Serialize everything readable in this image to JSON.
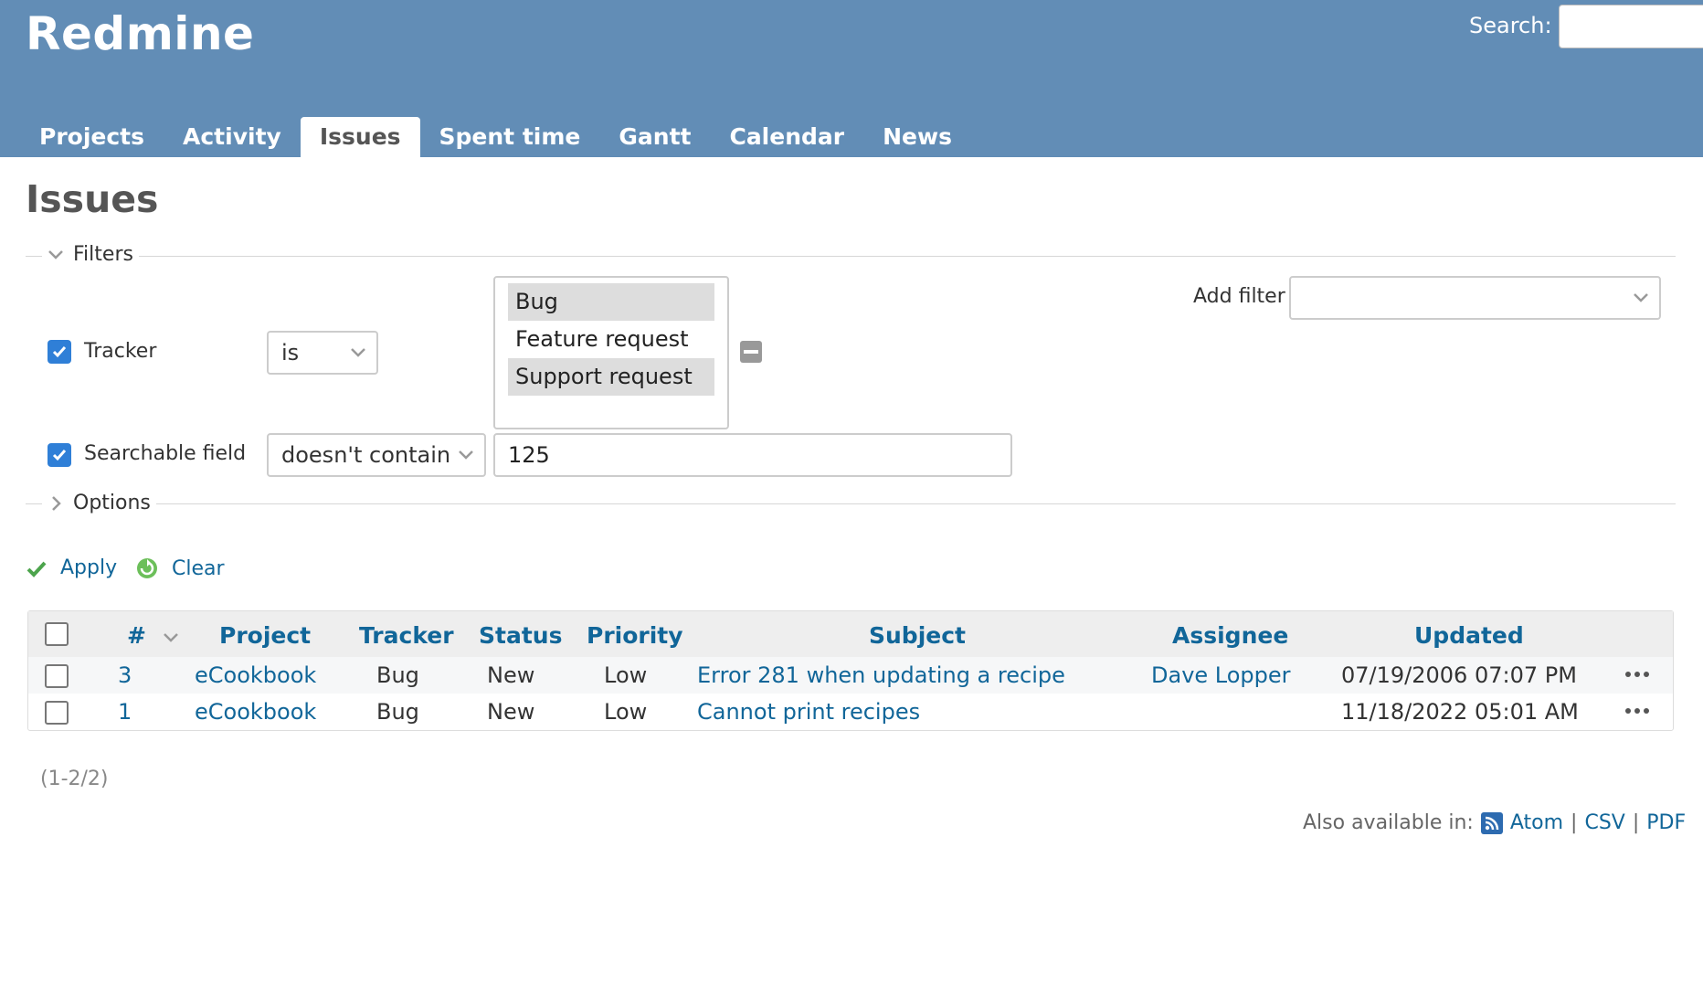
{
  "header": {
    "app_title": "Redmine",
    "search_label": "Search:",
    "search_value": "",
    "tabs": [
      {
        "label": "Projects"
      },
      {
        "label": "Activity"
      },
      {
        "label": "Issues",
        "selected": true
      },
      {
        "label": "Spent time"
      },
      {
        "label": "Gantt"
      },
      {
        "label": "Calendar"
      },
      {
        "label": "News"
      }
    ]
  },
  "main": {
    "title": "Issues",
    "filters": {
      "legend": "Filters",
      "tracker": {
        "checked": true,
        "label": "Tracker",
        "operator": "is",
        "options": [
          {
            "label": "Bug",
            "selected": true
          },
          {
            "label": "Feature request",
            "selected": false
          },
          {
            "label": "Support request",
            "selected": true
          }
        ]
      },
      "searchable": {
        "checked": true,
        "label": "Searchable field",
        "operator": "doesn't contain",
        "value": "125"
      },
      "add_filter_label": "Add filter",
      "add_filter_value": ""
    },
    "options_legend": "Options",
    "actions": {
      "apply": "Apply",
      "clear": "Clear"
    },
    "table": {
      "headers": {
        "id": "#",
        "project": "Project",
        "tracker": "Tracker",
        "status": "Status",
        "priority": "Priority",
        "subject": "Subject",
        "assignee": "Assignee",
        "updated": "Updated"
      },
      "rows": [
        {
          "id": "3",
          "project": "eCookbook",
          "tracker": "Bug",
          "status": "New",
          "priority": "Low",
          "subject": "Error 281 when updating a recipe",
          "assignee": "Dave Lopper",
          "updated": "07/19/2006 07:07 PM"
        },
        {
          "id": "1",
          "project": "eCookbook",
          "tracker": "Bug",
          "status": "New",
          "priority": "Low",
          "subject": "Cannot print recipes",
          "assignee": "",
          "updated": "11/18/2022 05:01 AM"
        }
      ]
    },
    "pagination": "(1-2/2)",
    "also_available": {
      "label": "Also available in:",
      "atom": "Atom",
      "sep": "|",
      "csv": "CSV",
      "pdf": "PDF"
    }
  },
  "colors": {
    "header_bg": "#628db6",
    "link": "#116699",
    "checkbox": "#2f7fd7"
  },
  "icons": [
    "chevron-down-icon",
    "chevron-right-icon",
    "checkmark-icon",
    "refresh-icon",
    "rss-feed-icon",
    "ellipsis-icon",
    "minus-icon",
    "sort-desc-icon"
  ]
}
